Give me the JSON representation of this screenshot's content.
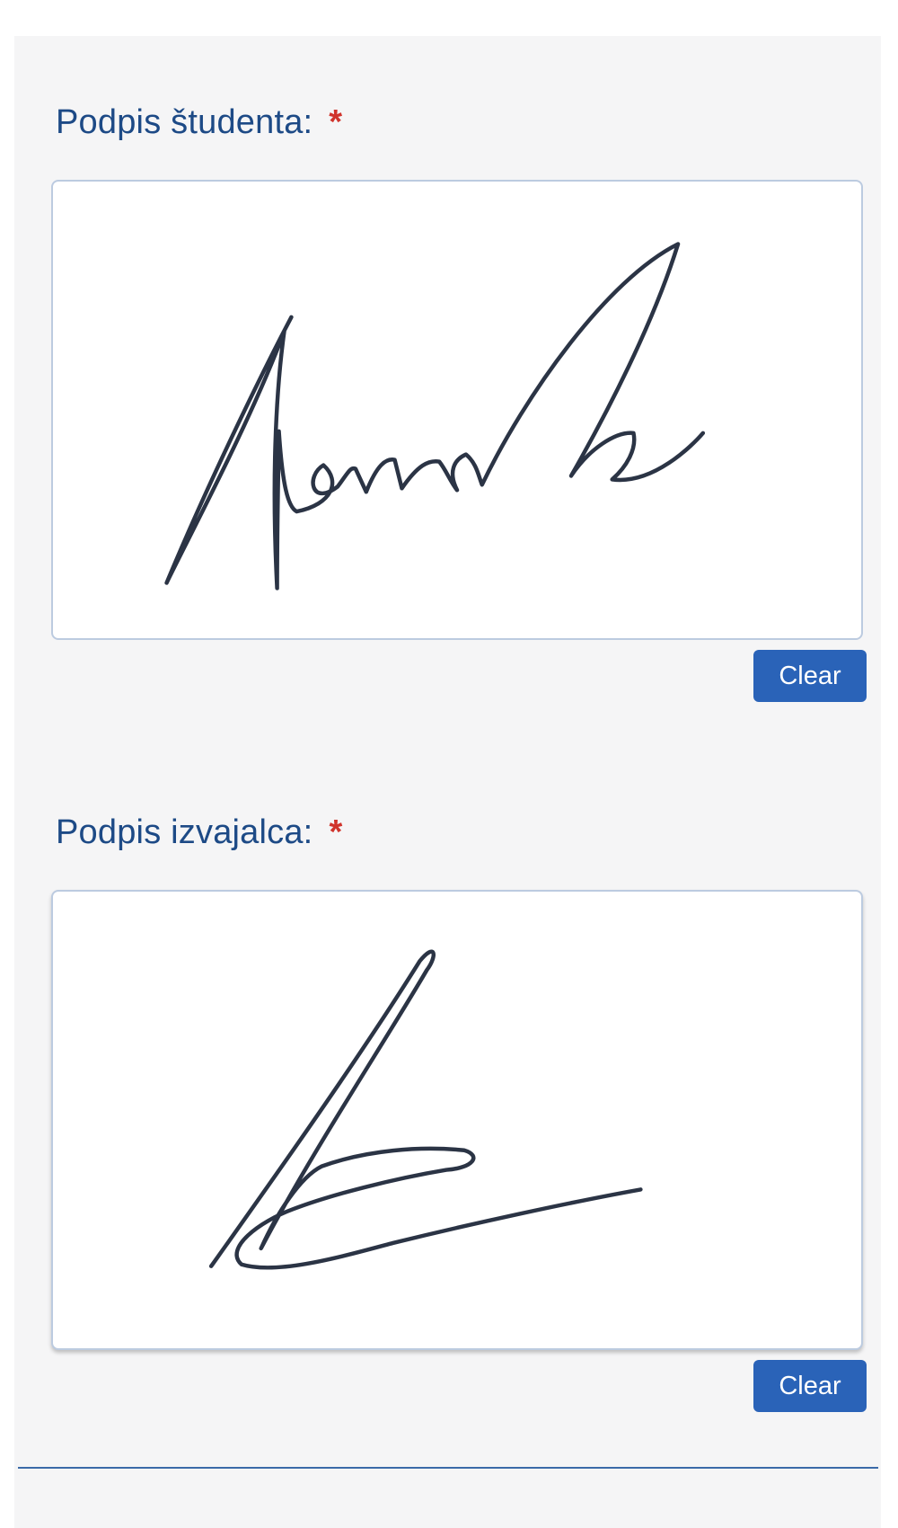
{
  "student_signature": {
    "label": "Podpis študenta:",
    "required_marker": "*",
    "clear_label": "Clear"
  },
  "provider_signature": {
    "label": "Podpis izvajalca:",
    "required_marker": "*",
    "clear_label": "Clear"
  },
  "colors": {
    "label": "#1d4a86",
    "required": "#d0342c",
    "button": "#2a63b8",
    "ink": "#2b3445"
  }
}
